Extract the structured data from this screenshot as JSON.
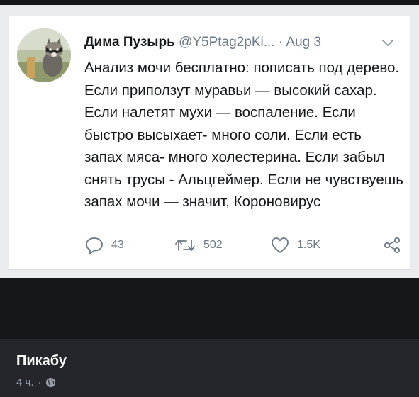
{
  "tweet": {
    "display_name": "Дима Пузырь",
    "handle": "@Y5Ptag2pKi...",
    "separator": "·",
    "date": "Aug 3",
    "text": "Анализ мочи бесплатно: пописать под дерево. Если приползут муравьи — высокий сахар. Если налетят мухи — воспаление. Если быстро высыхает- много соли. Если есть запах мяса- много холестерина. Если забыл снять трусы - Альцгеймер. Если не чувствуешь запах мочи — значит, Короновирус",
    "replies": "43",
    "retweets": "502",
    "likes": "1.5K",
    "icons": [
      "raccoon-avatar",
      "chevron-down-icon",
      "reply-icon",
      "retweet-icon",
      "heart-icon",
      "share-icon"
    ]
  },
  "post": {
    "source": "Пикабу",
    "time": "4 ч.",
    "separator": "·",
    "privacy_icon": "globe-icon"
  },
  "colors": {
    "page_background": "#15171b",
    "tweet_frame": "#e9ebed",
    "tweet_card": "#ffffff",
    "text_primary": "#14171a",
    "text_secondary": "#6b7a87",
    "footer_background": "#24262b"
  }
}
